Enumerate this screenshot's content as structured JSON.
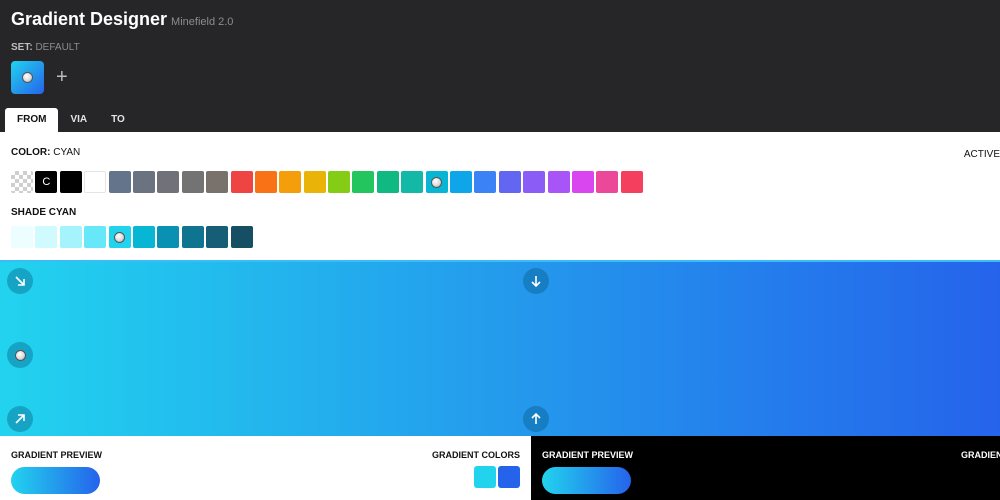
{
  "header": {
    "title": "Gradient Designer",
    "version": "Minefield 2.0",
    "set_key": "SET:",
    "set_value": "DEFAULT",
    "add_label": "+"
  },
  "tabs": [
    {
      "label": "FROM",
      "active": true
    },
    {
      "label": "VIA",
      "active": false
    },
    {
      "label": "TO",
      "active": false
    }
  ],
  "color_panel": {
    "label": "COLOR:",
    "value": "CYAN",
    "active_label": "ACTIVE",
    "current_glyph": "C",
    "swatches": [
      "transparent",
      "current",
      "#000000",
      "#ffffff",
      "#64748b",
      "#6b7280",
      "#71717a",
      "#737373",
      "#78716c",
      "#ef4444",
      "#f97316",
      "#f59e0b",
      "#eab308",
      "#84cc16",
      "#22c55e",
      "#10b981",
      "#14b8a6",
      "#06b6d4",
      "#0ea5e9",
      "#3b82f6",
      "#6366f1",
      "#8b5cf6",
      "#a855f7",
      "#d946ef",
      "#ec4899",
      "#f43f5e"
    ],
    "selected_index": 17
  },
  "shade_panel": {
    "label": "SHADE",
    "value": "CYAN",
    "shades": [
      "#ecfeff",
      "#cffafe",
      "#a5f3fc",
      "#67e8f9",
      "#22d3ee",
      "#06b6d4",
      "#0891b2",
      "#0e7490",
      "#155e75",
      "#164e63"
    ],
    "selected_index": 4
  },
  "preview": {
    "from_color": "#22d3ee",
    "to_color": "#2563eb"
  },
  "bottom": {
    "preview_label_light": "GRADIENT PREVIEW",
    "colors_label_light": "GRADIENT COLORS",
    "preview_label_dark": "GRADIENT PREVIEW",
    "colors_label_dark": "GRADIENT COLORS",
    "chip_colors": [
      "#22d3ee",
      "#2563eb"
    ]
  }
}
